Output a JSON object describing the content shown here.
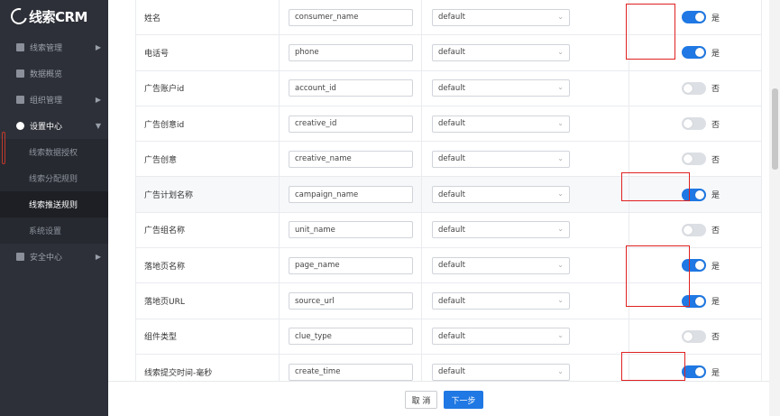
{
  "app": {
    "logo_text": "线索CRM"
  },
  "sidebar": {
    "items": [
      {
        "label": "线索管理"
      },
      {
        "label": "数据概览"
      },
      {
        "label": "组织管理"
      },
      {
        "label": "设置中心"
      },
      {
        "label": "线索数据授权"
      },
      {
        "label": "线索分配规则"
      },
      {
        "label": "线索推送规则"
      },
      {
        "label": "系统设置"
      },
      {
        "label": "安全中心"
      }
    ]
  },
  "rows": [
    {
      "name": "姓名",
      "field": "consumer_name",
      "format": "default",
      "enabled": true,
      "toggle_label": "是"
    },
    {
      "name": "电话号",
      "field": "phone",
      "format": "default",
      "enabled": true,
      "toggle_label": "是"
    },
    {
      "name": "广告账户id",
      "field": "account_id",
      "format": "default",
      "enabled": false,
      "toggle_label": "否"
    },
    {
      "name": "广告创意id",
      "field": "creative_id",
      "format": "default",
      "enabled": false,
      "toggle_label": "否"
    },
    {
      "name": "广告创意",
      "field": "creative_name",
      "format": "default",
      "enabled": false,
      "toggle_label": "否"
    },
    {
      "name": "广告计划名称",
      "field": "campaign_name",
      "format": "default",
      "enabled": true,
      "toggle_label": "是"
    },
    {
      "name": "广告组名称",
      "field": "unit_name",
      "format": "default",
      "enabled": false,
      "toggle_label": "否"
    },
    {
      "name": "落地页名称",
      "field": "page_name",
      "format": "default",
      "enabled": true,
      "toggle_label": "是"
    },
    {
      "name": "落地页URL",
      "field": "source_url",
      "format": "default",
      "enabled": true,
      "toggle_label": "是"
    },
    {
      "name": "组件类型",
      "field": "clue_type",
      "format": "default",
      "enabled": false,
      "toggle_label": "否"
    },
    {
      "name": "线索提交时间-毫秒",
      "field": "create_time",
      "format": "default",
      "enabled": true,
      "toggle_label": "是"
    }
  ],
  "footer": {
    "cancel_label": "取 消",
    "next_label": "下一步"
  },
  "colors": {
    "accent": "#1f78e3",
    "sidebar_bg": "#2d3038",
    "highlight": "#e02020"
  }
}
